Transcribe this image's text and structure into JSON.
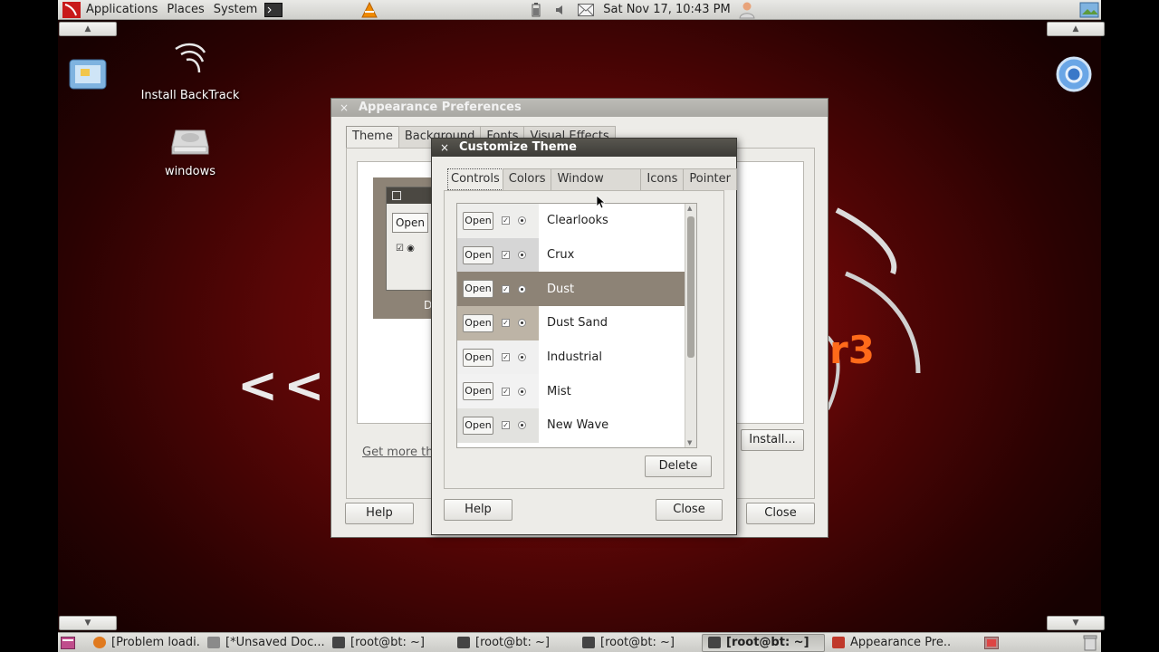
{
  "top_panel": {
    "menus": [
      "Applications",
      "Places",
      "System"
    ],
    "clock": "Sat Nov 17, 10:43 PM"
  },
  "desktop": {
    "icons": [
      {
        "label": "Install BackTrack"
      },
      {
        "label": "windows"
      }
    ],
    "back_arrows": "<<",
    "logo_fragment": "r3"
  },
  "appearance_window": {
    "title": "Appearance Preferences",
    "tabs": [
      "Theme",
      "Background",
      "Fonts",
      "Visual Effects"
    ],
    "preview_button": "Open",
    "preview_caption": "D",
    "get_more_link": "Get more the",
    "install_button": "Install...",
    "help_button": "Help",
    "close_button": "Close"
  },
  "customize_window": {
    "title": "Customize Theme",
    "tabs": [
      "Controls",
      "Colors",
      "Window Border",
      "Icons",
      "Pointer"
    ],
    "active_tab": "Controls",
    "themes": [
      {
        "name": "Clearlooks",
        "selected": false,
        "swatch": "#eeeeec"
      },
      {
        "name": "Crux",
        "selected": false,
        "swatch": "#d6d6d6"
      },
      {
        "name": "Dust",
        "selected": true,
        "swatch": "#8d8376"
      },
      {
        "name": "Dust Sand",
        "selected": false,
        "swatch": "#bdb4a6"
      },
      {
        "name": "Industrial",
        "selected": false,
        "swatch": "#f0f0f0"
      },
      {
        "name": "Mist",
        "selected": false,
        "swatch": "#f2f2f2"
      },
      {
        "name": "New Wave",
        "selected": false,
        "swatch": "#e2e2df"
      }
    ],
    "open_label": "Open",
    "delete_button": "Delete",
    "help_button": "Help",
    "close_button": "Close"
  },
  "taskbar": {
    "items": [
      {
        "label": "[Problem loadi...",
        "icon": "firefox-icon"
      },
      {
        "label": "[*Unsaved Doc...",
        "icon": "text-editor-icon"
      },
      {
        "label": "[root@bt: ~]",
        "icon": "terminal-icon"
      },
      {
        "label": "[root@bt: ~]",
        "icon": "terminal-icon"
      },
      {
        "label": "[root@bt: ~]",
        "icon": "terminal-icon"
      },
      {
        "label": "[root@bt: ~]",
        "icon": "terminal-icon"
      },
      {
        "label": "Appearance Pre...",
        "icon": "appearance-icon"
      }
    ]
  },
  "colors": {
    "selection": "#8d8376",
    "titlebar_active": "#3c3b37",
    "desktop_red": "#8a0c0c"
  }
}
